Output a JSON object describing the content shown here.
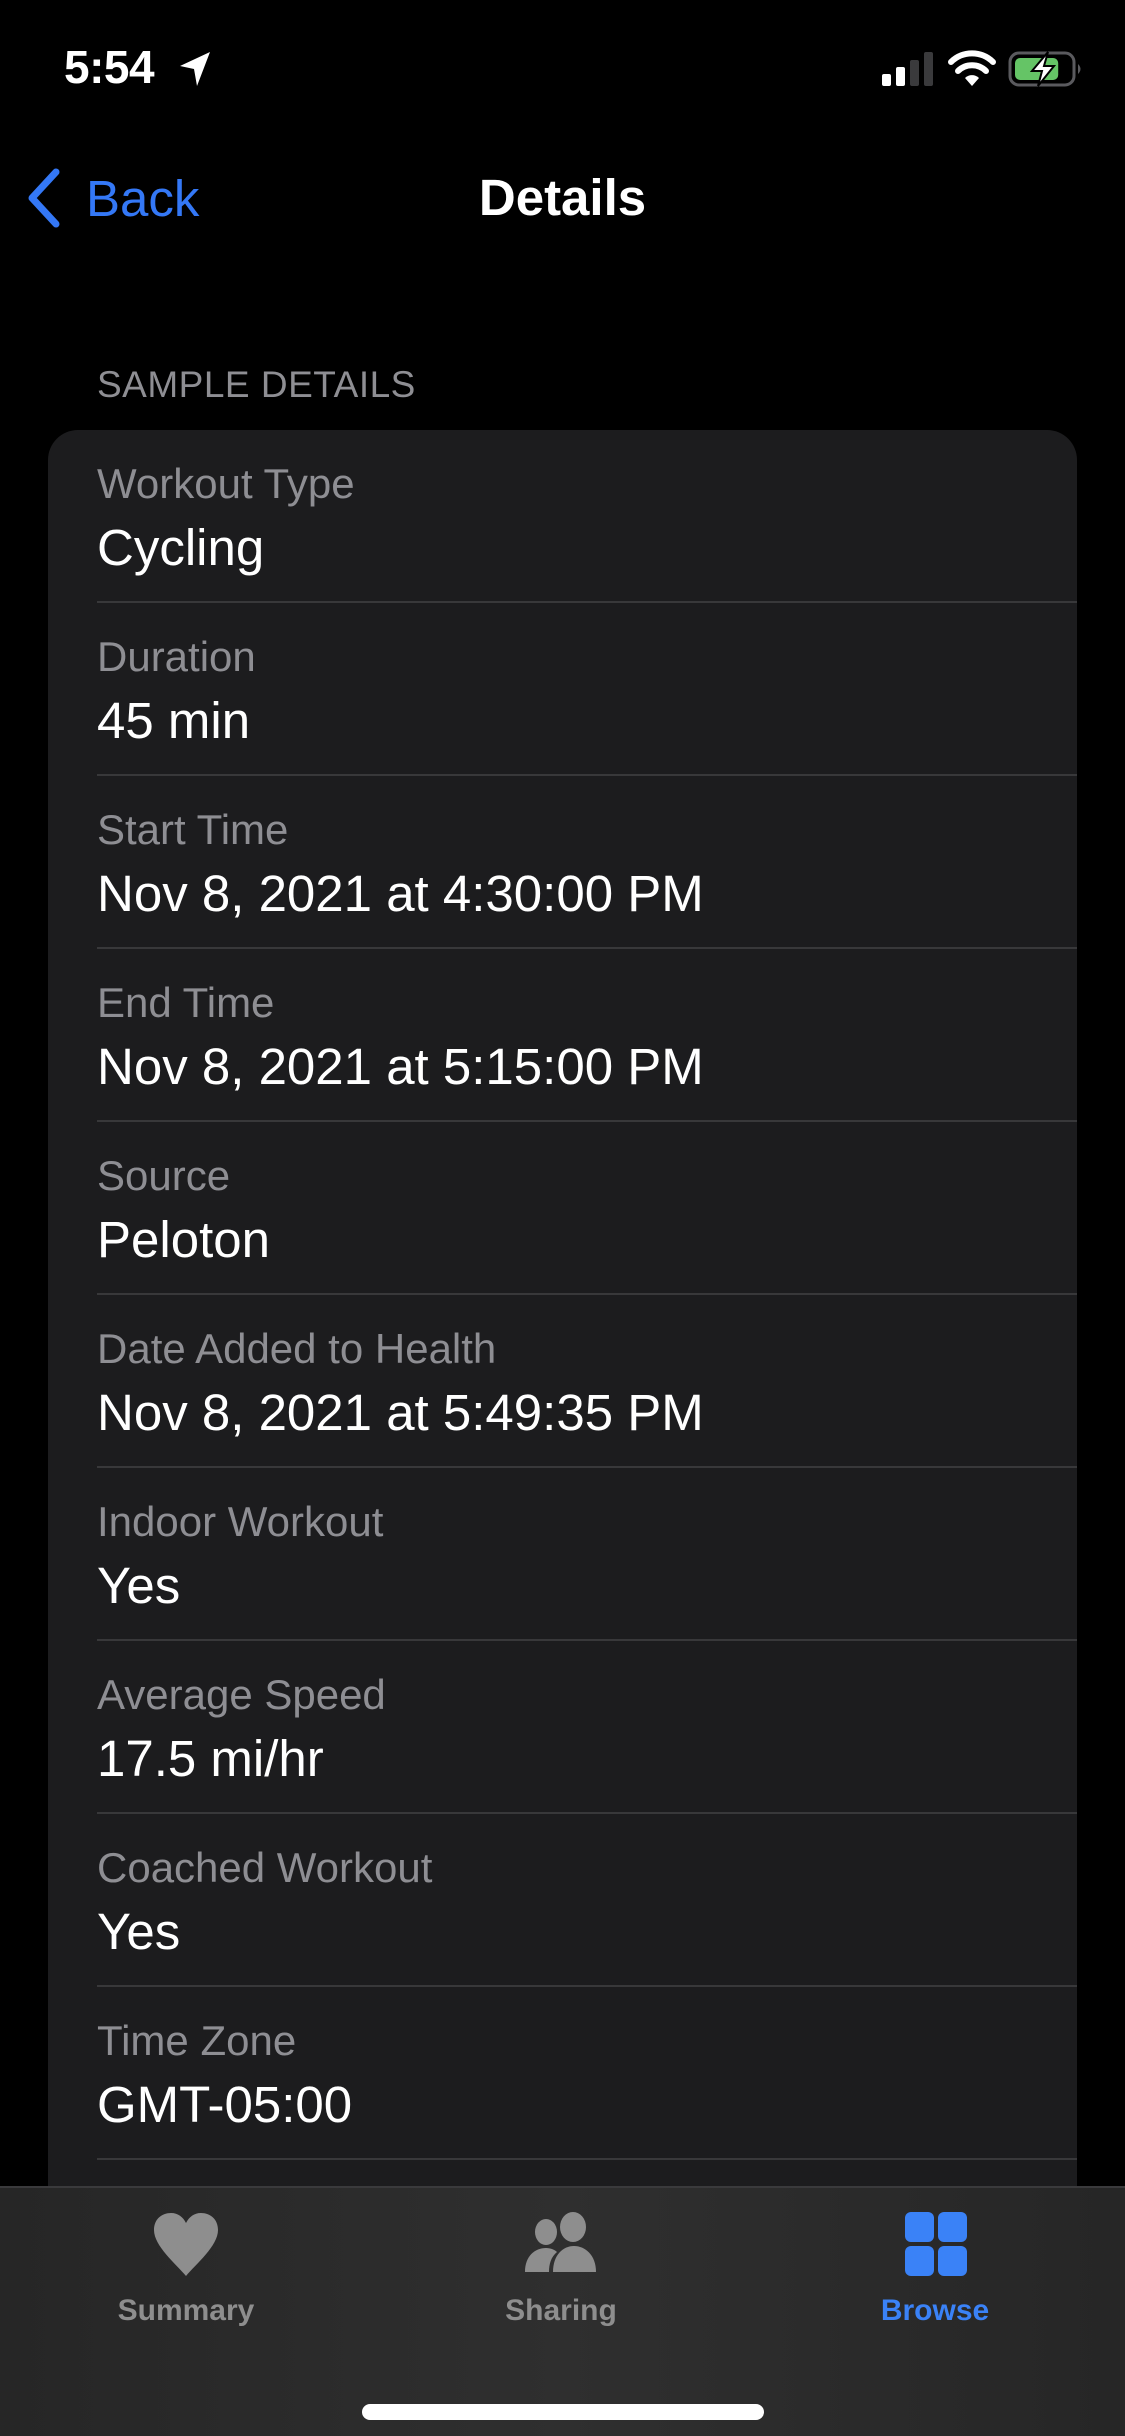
{
  "status_bar": {
    "time": "5:54",
    "location_icon": "location-arrow-icon",
    "signal_bars_active": 2,
    "signal_bars_total": 4,
    "wifi_icon": "wifi-icon",
    "battery_level": 0.8,
    "battery_charging": true,
    "battery_color": "#65c466"
  },
  "nav": {
    "back_label": "Back",
    "title": "Details",
    "accent_color": "#3478f6"
  },
  "section": {
    "header": "SAMPLE DETAILS",
    "rows": [
      {
        "label": "Workout Type",
        "value": "Cycling"
      },
      {
        "label": "Duration",
        "value": "45 min"
      },
      {
        "label": "Start Time",
        "value": "Nov 8, 2021 at 4:30:00 PM"
      },
      {
        "label": "End Time",
        "value": "Nov 8, 2021 at 5:15:00 PM"
      },
      {
        "label": "Source",
        "value": "Peloton"
      },
      {
        "label": "Date Added to Health",
        "value": "Nov 8, 2021 at 5:49:35 PM"
      },
      {
        "label": "Indoor Workout",
        "value": "Yes"
      },
      {
        "label": "Average Speed",
        "value": "17.5 mi/hr"
      },
      {
        "label": "Coached Workout",
        "value": "Yes"
      },
      {
        "label": "Time Zone",
        "value": "GMT-05:00"
      }
    ]
  },
  "tab_bar": {
    "tabs": [
      {
        "label": "Summary",
        "icon": "heart-icon",
        "selected": false
      },
      {
        "label": "Sharing",
        "icon": "people-icon",
        "selected": false
      },
      {
        "label": "Browse",
        "icon": "grid-icon",
        "selected": true
      }
    ],
    "selected_color": "#3a82f7",
    "unselected_color": "#8e8e8e"
  }
}
